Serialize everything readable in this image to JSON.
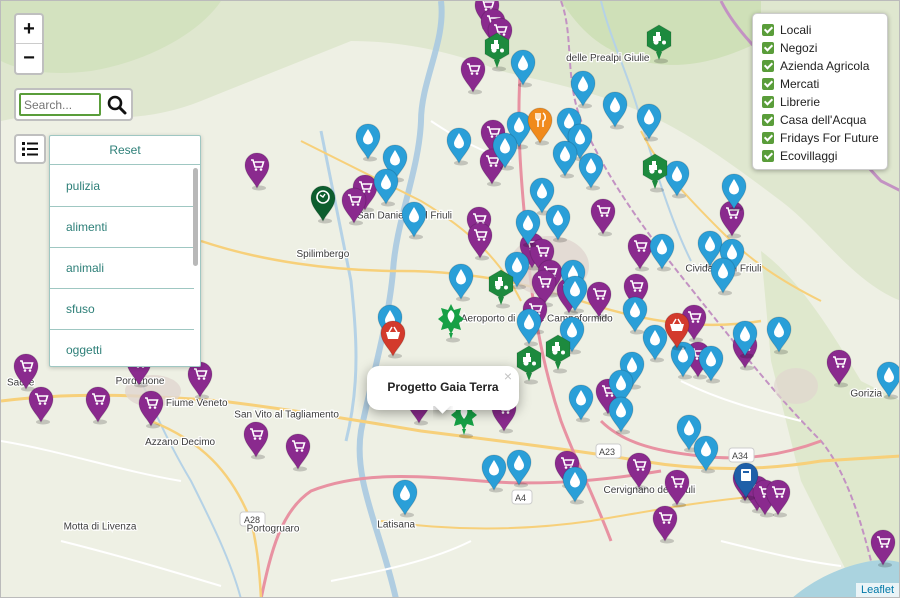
{
  "map": {
    "zoom_in_label": "+",
    "zoom_out_label": "−",
    "attribution": "Leaflet",
    "places": [
      {
        "name": "Spilimbergo",
        "lat": 46.111,
        "lon": 12.903
      },
      {
        "name": "San Daniele del Friuli",
        "lat": 46.158,
        "lon": 13.011
      },
      {
        "name": "Sacile",
        "lat": 45.954,
        "lon": 12.503
      },
      {
        "name": "Pordenone",
        "lat": 45.956,
        "lon": 12.661
      },
      {
        "name": "Fiume Veneto",
        "lat": 45.929,
        "lon": 12.736
      },
      {
        "name": "San Vito al Tagliamento",
        "lat": 45.915,
        "lon": 12.855
      },
      {
        "name": "Azzano Decimo",
        "lat": 45.882,
        "lon": 12.714
      },
      {
        "name": "Portogruaro",
        "lat": 45.776,
        "lon": 12.837
      },
      {
        "name": "Motta di Livenza",
        "lat": 45.779,
        "lon": 12.608
      },
      {
        "name": "Latisana",
        "lat": 45.781,
        "lon": 13.0
      },
      {
        "name": "Cervignano del Friuli",
        "lat": 45.823,
        "lon": 13.335
      },
      {
        "name": "Aeroporto di Udine Campoformido",
        "lat": 46.032,
        "lon": 13.186
      },
      {
        "name": "Cividale del Friuli",
        "lat": 46.093,
        "lon": 13.433
      },
      {
        "name": "Gorizia",
        "lat": 45.941,
        "lon": 13.622
      },
      {
        "name": "delle Prealpi Giulie",
        "lat": 46.35,
        "lon": 13.28
      }
    ],
    "roads": [
      "A28",
      "A4",
      "A23",
      "A34"
    ],
    "markers": [
      {
        "category": "Negozi",
        "lat": 46.39,
        "lon": 13.12
      },
      {
        "category": "Negozi",
        "lat": 46.37,
        "lon": 13.128
      },
      {
        "category": "Negozi",
        "lat": 46.36,
        "lon": 13.138
      },
      {
        "category": "Negozi",
        "lat": 46.312,
        "lon": 13.102
      },
      {
        "category": "Negozi",
        "lat": 46.235,
        "lon": 13.128
      },
      {
        "category": "Negozi",
        "lat": 46.2,
        "lon": 13.127
      },
      {
        "category": "Negozi",
        "lat": 46.168,
        "lon": 12.959
      },
      {
        "category": "Negozi",
        "lat": 46.152,
        "lon": 12.944
      },
      {
        "category": "Negozi",
        "lat": 46.195,
        "lon": 12.816
      },
      {
        "category": "Negozi",
        "lat": 46.129,
        "lon": 13.109
      },
      {
        "category": "Negozi",
        "lat": 46.11,
        "lon": 13.111
      },
      {
        "category": "Negozi",
        "lat": 46.098,
        "lon": 13.18
      },
      {
        "category": "Negozi",
        "lat": 46.09,
        "lon": 13.193
      },
      {
        "category": "Negozi",
        "lat": 46.064,
        "lon": 13.203
      },
      {
        "category": "Negozi",
        "lat": 46.053,
        "lon": 13.196
      },
      {
        "category": "Negozi",
        "lat": 46.043,
        "lon": 13.228
      },
      {
        "category": "Negozi",
        "lat": 46.038,
        "lon": 13.268
      },
      {
        "category": "Negozi",
        "lat": 46.02,
        "lon": 13.183
      },
      {
        "category": "Negozi",
        "lat": 46.139,
        "lon": 13.274
      },
      {
        "category": "Negozi",
        "lat": 46.136,
        "lon": 13.444
      },
      {
        "category": "Negozi",
        "lat": 46.096,
        "lon": 13.323
      },
      {
        "category": "Negozi",
        "lat": 46.047,
        "lon": 13.317
      },
      {
        "category": "Negozi",
        "lat": 46.01,
        "lon": 13.394
      },
      {
        "category": "Negozi",
        "lat": 45.965,
        "lon": 13.4
      },
      {
        "category": "Negozi",
        "lat": 45.975,
        "lon": 13.461
      },
      {
        "category": "Negozi",
        "lat": 45.955,
        "lon": 13.586
      },
      {
        "category": "Negozi",
        "lat": 45.919,
        "lon": 13.28
      },
      {
        "category": "Negozi",
        "lat": 45.908,
        "lon": 13.03
      },
      {
        "category": "Negozi",
        "lat": 45.899,
        "lon": 13.143
      },
      {
        "category": "Negozi",
        "lat": 45.95,
        "lon": 12.51
      },
      {
        "category": "Negozi",
        "lat": 45.91,
        "lon": 12.53
      },
      {
        "category": "Negozi",
        "lat": 45.91,
        "lon": 12.605
      },
      {
        "category": "Negozi",
        "lat": 45.905,
        "lon": 12.676
      },
      {
        "category": "Negozi",
        "lat": 45.94,
        "lon": 12.74
      },
      {
        "category": "Negozi",
        "lat": 45.955,
        "lon": 12.659
      },
      {
        "category": "Negozi",
        "lat": 45.867,
        "lon": 12.814
      },
      {
        "category": "Negozi",
        "lat": 45.852,
        "lon": 12.87
      },
      {
        "category": "Negozi",
        "lat": 45.832,
        "lon": 13.226
      },
      {
        "category": "Negozi",
        "lat": 45.829,
        "lon": 13.321
      },
      {
        "category": "Negozi",
        "lat": 45.808,
        "lon": 13.371
      },
      {
        "category": "Negozi",
        "lat": 45.813,
        "lon": 13.461
      },
      {
        "category": "Negozi",
        "lat": 45.801,
        "lon": 13.477
      },
      {
        "category": "Negozi",
        "lat": 45.796,
        "lon": 13.488
      },
      {
        "category": "Negozi",
        "lat": 45.797,
        "lon": 13.505
      },
      {
        "category": "Negozi",
        "lat": 45.765,
        "lon": 13.356
      },
      {
        "category": "Negozi",
        "lat": 45.735,
        "lon": 13.644
      },
      {
        "category": "Casa dell'Acqua",
        "lat": 46.32,
        "lon": 13.168
      },
      {
        "category": "Casa dell'Acqua",
        "lat": 46.295,
        "lon": 13.247
      },
      {
        "category": "Casa dell'Acqua",
        "lat": 46.27,
        "lon": 13.29
      },
      {
        "category": "Casa dell'Acqua",
        "lat": 46.255,
        "lon": 13.334
      },
      {
        "category": "Casa dell'Acqua",
        "lat": 46.25,
        "lon": 13.229
      },
      {
        "category": "Casa dell'Acqua",
        "lat": 46.245,
        "lon": 13.163
      },
      {
        "category": "Casa dell'Acqua",
        "lat": 46.23,
        "lon": 13.243
      },
      {
        "category": "Casa dell'Acqua",
        "lat": 46.225,
        "lon": 13.083
      },
      {
        "category": "Casa dell'Acqua",
        "lat": 46.23,
        "lon": 12.963
      },
      {
        "category": "Casa dell'Acqua",
        "lat": 46.205,
        "lon": 12.998
      },
      {
        "category": "Casa dell'Acqua",
        "lat": 46.22,
        "lon": 13.144
      },
      {
        "category": "Casa dell'Acqua",
        "lat": 46.21,
        "lon": 13.224
      },
      {
        "category": "Casa dell'Acqua",
        "lat": 46.195,
        "lon": 13.258
      },
      {
        "category": "Casa dell'Acqua",
        "lat": 46.185,
        "lon": 13.372
      },
      {
        "category": "Casa dell'Acqua",
        "lat": 46.175,
        "lon": 12.986
      },
      {
        "category": "Casa dell'Acqua",
        "lat": 46.165,
        "lon": 13.193
      },
      {
        "category": "Casa dell'Acqua",
        "lat": 46.17,
        "lon": 13.447
      },
      {
        "category": "Casa dell'Acqua",
        "lat": 46.135,
        "lon": 13.024
      },
      {
        "category": "Casa dell'Acqua",
        "lat": 46.125,
        "lon": 13.174
      },
      {
        "category": "Casa dell'Acqua",
        "lat": 46.132,
        "lon": 13.214
      },
      {
        "category": "Casa dell'Acqua",
        "lat": 46.1,
        "lon": 13.415
      },
      {
        "category": "Casa dell'Acqua",
        "lat": 46.096,
        "lon": 13.352
      },
      {
        "category": "Casa dell'Acqua",
        "lat": 46.09,
        "lon": 13.445
      },
      {
        "category": "Casa dell'Acqua",
        "lat": 46.074,
        "lon": 13.16
      },
      {
        "category": "Casa dell'Acqua",
        "lat": 46.065,
        "lon": 13.234
      },
      {
        "category": "Casa dell'Acqua",
        "lat": 46.067,
        "lon": 13.432
      },
      {
        "category": "Casa dell'Acqua",
        "lat": 46.06,
        "lon": 13.086
      },
      {
        "category": "Casa dell'Acqua",
        "lat": 46.045,
        "lon": 13.236
      },
      {
        "category": "Casa dell'Acqua",
        "lat": 46.02,
        "lon": 13.316
      },
      {
        "category": "Casa dell'Acqua",
        "lat": 46.01,
        "lon": 12.992
      },
      {
        "category": "Casa dell'Acqua",
        "lat": 46.005,
        "lon": 13.176
      },
      {
        "category": "Casa dell'Acqua",
        "lat": 45.995,
        "lon": 13.233
      },
      {
        "category": "Casa dell'Acqua",
        "lat": 45.99,
        "lon": 13.462
      },
      {
        "category": "Casa dell'Acqua",
        "lat": 45.995,
        "lon": 13.507
      },
      {
        "category": "Casa dell'Acqua",
        "lat": 45.985,
        "lon": 13.343
      },
      {
        "category": "Casa dell'Acqua",
        "lat": 45.965,
        "lon": 13.38
      },
      {
        "category": "Casa dell'Acqua",
        "lat": 45.96,
        "lon": 13.416
      },
      {
        "category": "Casa dell'Acqua",
        "lat": 45.952,
        "lon": 13.312
      },
      {
        "category": "Casa dell'Acqua",
        "lat": 45.93,
        "lon": 13.298
      },
      {
        "category": "Casa dell'Acqua",
        "lat": 45.912,
        "lon": 13.244
      },
      {
        "category": "Casa dell'Acqua",
        "lat": 45.898,
        "lon": 13.298
      },
      {
        "category": "Casa dell'Acqua",
        "lat": 45.876,
        "lon": 13.388
      },
      {
        "category": "Casa dell'Acqua",
        "lat": 45.85,
        "lon": 13.41
      },
      {
        "category": "Casa dell'Acqua",
        "lat": 45.833,
        "lon": 13.163
      },
      {
        "category": "Casa dell'Acqua",
        "lat": 45.827,
        "lon": 13.13
      },
      {
        "category": "Casa dell'Acqua",
        "lat": 45.812,
        "lon": 13.236
      },
      {
        "category": "Casa dell'Acqua",
        "lat": 45.797,
        "lon": 13.012
      },
      {
        "category": "Casa dell'Acqua",
        "lat": 45.94,
        "lon": 13.652
      },
      {
        "category": "Azienda Agricola",
        "lat": 46.34,
        "lon": 13.134
      },
      {
        "category": "Azienda Agricola",
        "lat": 46.35,
        "lon": 13.348
      },
      {
        "category": "Azienda Agricola",
        "lat": 46.193,
        "lon": 13.342
      },
      {
        "category": "Azienda Agricola",
        "lat": 46.051,
        "lon": 13.139
      },
      {
        "category": "Azienda Agricola",
        "lat": 45.972,
        "lon": 13.214
      },
      {
        "category": "Azienda Agricola",
        "lat": 45.958,
        "lon": 13.176
      },
      {
        "category": "Ecovillaggi",
        "lat": 46.01,
        "lon": 13.072
      },
      {
        "category": "Ecovillaggi",
        "lat": 45.893,
        "lon": 13.09
      },
      {
        "category": "Fridays For Future",
        "lat": 46.155,
        "lon": 12.903
      },
      {
        "category": "Locali",
        "lat": 46.25,
        "lon": 13.19
      },
      {
        "category": "Mercati",
        "lat": 45.99,
        "lon": 12.996
      },
      {
        "category": "Mercati",
        "lat": 46.0,
        "lon": 13.372
      },
      {
        "category": "Librerie",
        "lat": 45.817,
        "lon": 13.463
      }
    ]
  },
  "search": {
    "placeholder": "Search...",
    "value": ""
  },
  "tags": {
    "reset_label": "Reset",
    "items": [
      "pulizia",
      "alimenti",
      "animali",
      "sfuso",
      "oggetti"
    ]
  },
  "layers": {
    "items": [
      {
        "label": "Locali",
        "checked": true
      },
      {
        "label": "Negozi",
        "checked": true
      },
      {
        "label": "Azienda Agricola",
        "checked": true
      },
      {
        "label": "Mercati",
        "checked": true
      },
      {
        "label": "Librerie",
        "checked": true
      },
      {
        "label": "Casa dell'Acqua",
        "checked": true
      },
      {
        "label": "Fridays For Future",
        "checked": true
      },
      {
        "label": "Ecovillaggi",
        "checked": true
      }
    ]
  },
  "popup": {
    "title": "Progetto Gaia Terra",
    "close_label": "×"
  },
  "colors": {
    "Negozi": "#8a2a8e",
    "Casa dell'Acqua": "#2a9fd8",
    "Azienda Agricola": "#1d8a3e",
    "Ecovillaggi": "#16a045",
    "Fridays For Future": "#0d5e2e",
    "Locali": "#f08a1c",
    "Mercati": "#d33a2c",
    "Librerie": "#1f5fa8",
    "checkbox": "#5a9d3a",
    "accent": "#2d7f78"
  }
}
